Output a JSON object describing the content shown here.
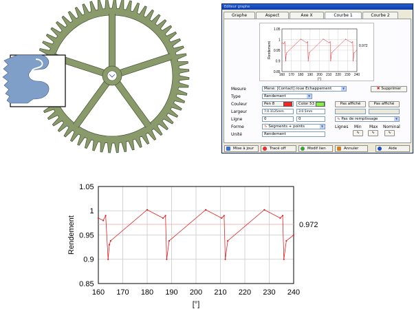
{
  "dialog": {
    "title": "Editeur graphe",
    "tabs": [
      {
        "label": "Graphe",
        "active": false
      },
      {
        "label": "Aspect",
        "active": false
      },
      {
        "label": "Axe X",
        "active": false
      },
      {
        "label": "Courbe 1",
        "active": true
      },
      {
        "label": "Courbe 2",
        "active": false
      }
    ],
    "form": {
      "mesure_label": "Mesure",
      "mesure_value": "Mené: [Contact] roue Echappement",
      "type_label": "Type",
      "type_value": "Rendement",
      "couleur_label": "Couleur",
      "couleur_pen": "Pen 8",
      "couleur_color": "Color 53",
      "largeur_label": "Largeur",
      "largeur_value1": "7.0.3125mm",
      "largeur_value2": "3:0.5mm",
      "ligne_label": "Ligne",
      "ligne_value1": "0",
      "ligne_value2": "0",
      "forme_label": "Forme",
      "forme_value": "Segments + points",
      "unite_label": "Unité",
      "unite_value": "Rendement",
      "supprimer": "Supprimer",
      "pas_affiche_1": "Pas affiché",
      "pas_affiche_2": "Pas affiché",
      "remplissage": "Pas de remplissage",
      "lignes": "Lignes",
      "min": "Min",
      "max": "Max",
      "nominal": "Nominal"
    },
    "buttons": {
      "mise_a_jour": "Mise à jour",
      "trace_off": "Tracé off",
      "modif_lien": "Modif lien",
      "annuler": "Annuler",
      "aide": "Aide"
    },
    "colors": {
      "pen": "#ff2020",
      "color53": "#88ee44"
    }
  },
  "mini_chart": {
    "ylabel": "Rendement",
    "xlabel": "[°]",
    "nominal_label": "0.972",
    "y_ticks": [
      "1.05",
      "1",
      "0.95",
      "0.9",
      "0.85"
    ],
    "x_ticks": [
      "160",
      "170",
      "180",
      "190",
      "200",
      "210",
      "220",
      "230",
      "240"
    ]
  },
  "chart_data": {
    "type": "line",
    "ylabel": "Rendement",
    "xlabel": "[°]",
    "xlim": [
      160,
      240
    ],
    "ylim": [
      0.85,
      1.05
    ],
    "x_ticks": [
      160,
      170,
      180,
      190,
      200,
      210,
      220,
      230,
      240
    ],
    "y_ticks": [
      1.05,
      1,
      0.95,
      0.9,
      0.85
    ],
    "x_tick_labels": [
      "160",
      "170",
      "180",
      "190",
      "200",
      "210",
      "220",
      "230",
      "240"
    ],
    "y_tick_labels": [
      "1.05",
      "1",
      "0.95",
      "0.9",
      "0.85"
    ],
    "nominal": 0.972,
    "nominal_label": "0.972",
    "grid": true,
    "series": [
      {
        "color": "#e02020",
        "x": [
          160,
          162,
          163,
          164,
          164.5,
          165,
          180,
          186.5,
          187.5,
          188,
          189,
          204,
          210.5,
          211.5,
          212,
          213,
          228,
          234.5,
          235.5,
          236,
          237,
          240
        ],
        "y": [
          0.985,
          0.98,
          0.99,
          0.9,
          0.93,
          0.938,
          1.002,
          0.985,
          0.99,
          0.9,
          0.938,
          1.002,
          0.985,
          0.99,
          0.9,
          0.938,
          1.002,
          0.985,
          0.99,
          0.9,
          0.938,
          0.95
        ]
      }
    ]
  }
}
